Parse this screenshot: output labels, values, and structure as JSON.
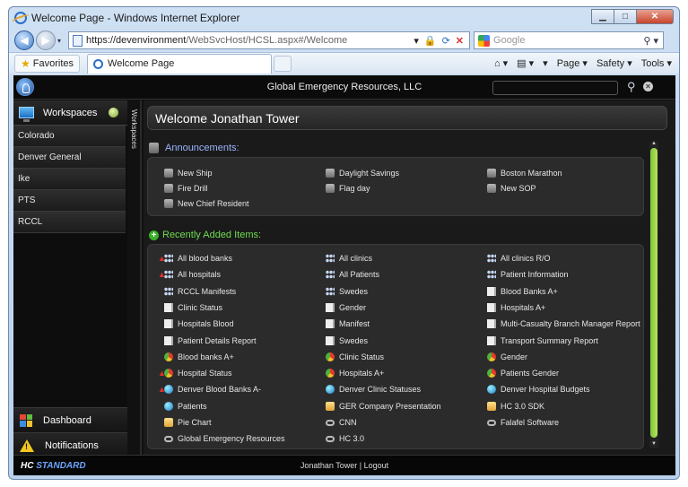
{
  "browser": {
    "window_title": "Welcome Page - Windows Internet Explorer",
    "url_https": "https://dev",
    "url_host": "environment",
    "url_rest": "/WebSvcHost/HCSL.aspx#/Welcome",
    "search_placeholder": "Google",
    "favorites_label": "Favorites",
    "tab_title": "Welcome Page",
    "cmd_page": "Page ▾",
    "cmd_safety": "Safety ▾",
    "cmd_tools": "Tools ▾"
  },
  "app": {
    "org_name": "Global Emergency Resources, LLC",
    "workspaces_label": "Workspaces",
    "vertical_tab": "Workspaces",
    "workspaces": [
      "Colorado",
      "Denver General",
      "Ike",
      "PTS",
      "RCCL"
    ],
    "bottom_nav": [
      "Dashboard",
      "Notifications"
    ],
    "welcome": "Welcome Jonathan Tower",
    "announcements_title": "Announcements:",
    "announcements": [
      [
        "New Ship",
        "Daylight Savings",
        "Boston Marathon"
      ],
      [
        "Fire Drill",
        "Flag day",
        "New SOP"
      ],
      [
        "New Chief Resident"
      ]
    ],
    "recent_title": "Recently Added Items:",
    "recent": [
      [
        {
          "t": "All blood banks",
          "i": "people",
          "f": true
        },
        {
          "t": "All clinics",
          "i": "people"
        },
        {
          "t": "All clinics R/O",
          "i": "people"
        }
      ],
      [
        {
          "t": "All hospitals",
          "i": "people",
          "f": true
        },
        {
          "t": "All Patients",
          "i": "people"
        },
        {
          "t": "Patient Information",
          "i": "people"
        }
      ],
      [
        {
          "t": "RCCL Manifests",
          "i": "people"
        },
        {
          "t": "Swedes",
          "i": "people"
        },
        {
          "t": "Blood Banks A+",
          "i": "doc"
        }
      ],
      [
        {
          "t": "Clinic Status",
          "i": "doc"
        },
        {
          "t": "Gender",
          "i": "doc"
        },
        {
          "t": "Hospitals A+",
          "i": "doc"
        }
      ],
      [
        {
          "t": "Hospitals Blood",
          "i": "doc"
        },
        {
          "t": "Manifest",
          "i": "doc"
        },
        {
          "t": "Multi-Casualty Branch Manager Report",
          "i": "doc"
        }
      ],
      [
        {
          "t": "Patient Details Report",
          "i": "doc"
        },
        {
          "t": "Swedes",
          "i": "doc"
        },
        {
          "t": "Transport Summary Report",
          "i": "doc"
        }
      ],
      [
        {
          "t": "Blood banks A+",
          "i": "pie"
        },
        {
          "t": "Clinic Status",
          "i": "pie"
        },
        {
          "t": "Gender",
          "i": "pie"
        }
      ],
      [
        {
          "t": "Hospital Status",
          "i": "pie",
          "f": true
        },
        {
          "t": "Hospitals A+",
          "i": "pie"
        },
        {
          "t": "Patients Gender",
          "i": "pie"
        }
      ],
      [
        {
          "t": "Denver Blood Banks A-",
          "i": "globe",
          "f": true
        },
        {
          "t": "Denver Clinic Statuses",
          "i": "globe"
        },
        {
          "t": "Denver Hospital Budgets",
          "i": "globe"
        }
      ],
      [
        {
          "t": "Patients",
          "i": "globe"
        },
        {
          "t": "GER Company Presentation",
          "i": "folder"
        },
        {
          "t": "HC 3.0 SDK",
          "i": "folder"
        }
      ],
      [
        {
          "t": "Pie Chart",
          "i": "folder"
        },
        {
          "t": "CNN",
          "i": "link"
        },
        {
          "t": "Falafel Software",
          "i": "link"
        }
      ],
      [
        {
          "t": "Global Emergency Resources",
          "i": "link"
        },
        {
          "t": "HC 3.0",
          "i": "link"
        }
      ]
    ],
    "footer_brand_a": "HC",
    "footer_brand_b": "STANDARD",
    "footer_user": "Jonathan Tower",
    "footer_sep": "|",
    "footer_logout": "Logout"
  }
}
